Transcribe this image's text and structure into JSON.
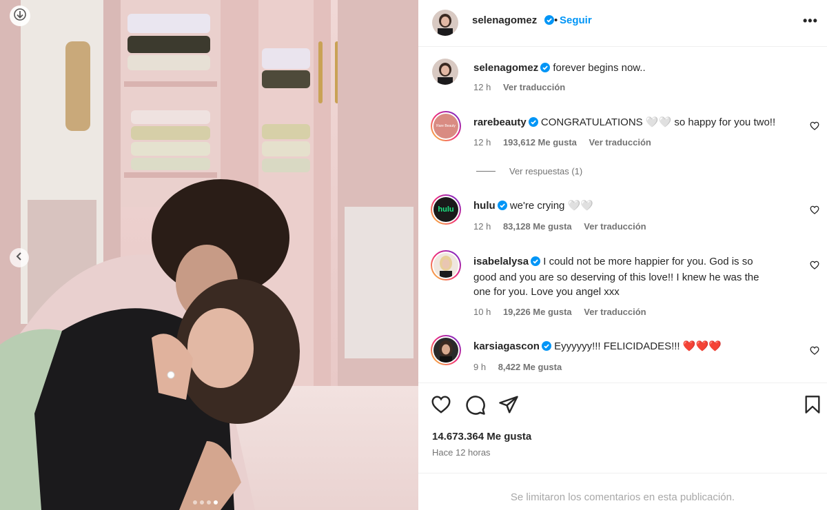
{
  "post": {
    "author": "selenagomez",
    "follow_label": "Seguir",
    "more_label": "•••",
    "caption": {
      "user": "selenagomez",
      "text": "forever begins now..",
      "age": "12 h",
      "translate": "Ver traducción"
    },
    "comments": [
      {
        "user": "rarebeauty",
        "text": "CONGRATULATIONS 🤍🤍 so happy for you two!!",
        "age": "12 h",
        "likes": "193,612 Me gusta",
        "translate": "Ver traducción",
        "avatar_text": "Rare Beauty"
      },
      {
        "user": "hulu",
        "text": "we're crying 🤍🤍",
        "age": "12 h",
        "likes": "83,128 Me gusta",
        "translate": "Ver traducción",
        "avatar_text": "hulu"
      },
      {
        "user": "isabelalysa",
        "text_lines": [
          "I could not be more happier for you. God is so",
          "good and you are so deserving of this love!! I knew he was the",
          "one for you. Love you angel xxx"
        ],
        "age": "10 h",
        "likes": "19,226 Me gusta",
        "translate": "Ver traducción"
      },
      {
        "user": "karsiagascon",
        "text": "Eyyyyyy!!! FELICIDADES!!! ❤️❤️❤️",
        "age": "9 h",
        "likes": "8,422 Me gusta"
      }
    ],
    "view_replies": "Ver respuestas (1)",
    "likes_total": "14.673.364 Me gusta",
    "posted_ago": "Hace 12 horas",
    "comments_limited": "Se limitaron los comentarios en esta publicación.",
    "carousel": {
      "count": 4,
      "active": 3
    }
  },
  "colors": {
    "verified": "#0095f6",
    "follow": "#0095f6",
    "story_ring_a": "#f9ce34",
    "story_ring_b": "#ee2a7b",
    "story_ring_c": "#6228d7",
    "heart_red": "#e0245e"
  },
  "icons": [
    "download-icon",
    "chevron-left-icon",
    "more-icon",
    "heart-icon",
    "comment-icon",
    "share-icon",
    "bookmark-icon",
    "verified-icon"
  ]
}
